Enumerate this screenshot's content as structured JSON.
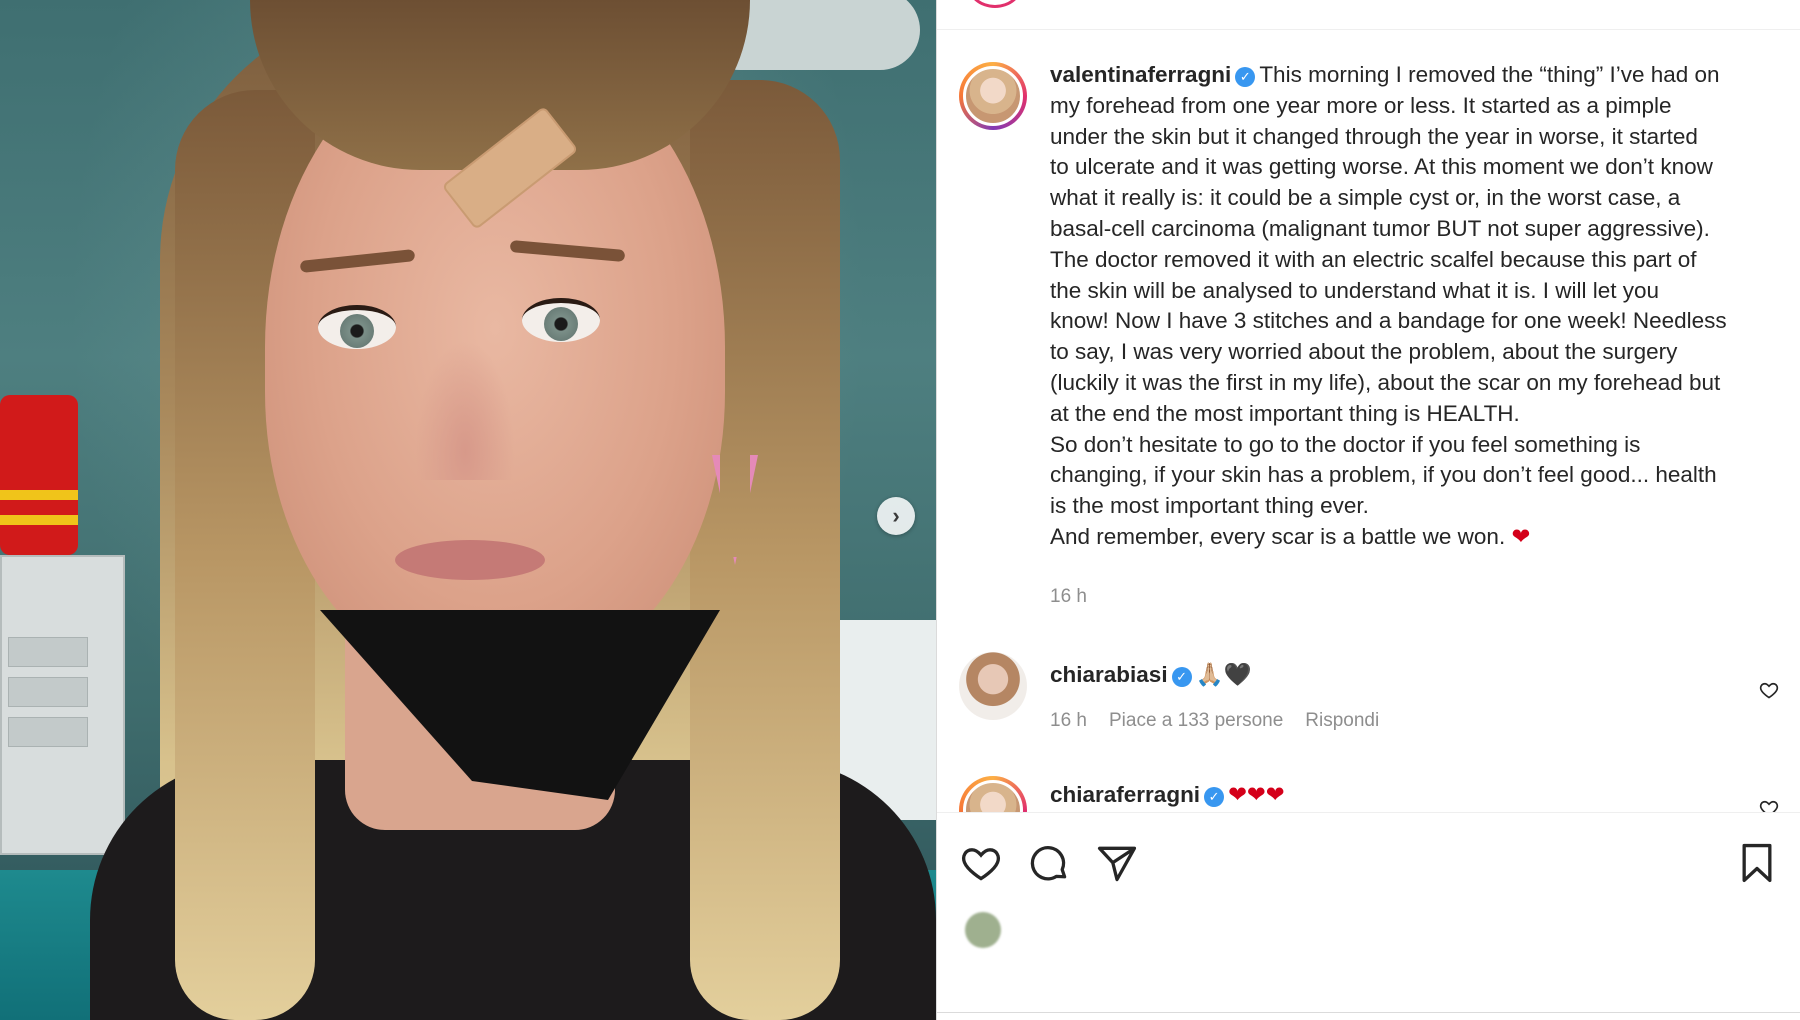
{
  "post": {
    "author": "valentinaferragni",
    "caption_lines": [
      "This morning I removed the “thing” I’ve had on",
      "my forehead from one year more or less. It started as a pimple",
      "under the skin but it changed through the year in worse, it started",
      "to ulcerate and it was getting worse. At this moment we don’t know",
      "what it really is: it could be a simple cyst or, in the worst case, a",
      "basal-cell carcinoma (malignant tumor BUT not super aggressive).",
      "The doctor removed it with an electric scalfel because this part of",
      "the skin will be analysed to understand what it is. I will let you",
      "know! Now I have 3 stitches and a bandage for one week! Needless",
      "to say, I was very worried about the problem, about the surgery",
      "(luckily it was the first in my life), about the scar on my forehead but",
      "at the end the most important thing is HEALTH.",
      "So don’t hesitate to go to the doctor if you feel something is",
      "changing, if your skin has a problem, if you don’t feel good... health",
      "is the most important thing ever.",
      "And remember, every scar is a battle we won."
    ],
    "caption_end_emoji": "❤",
    "time": "16 h"
  },
  "comments": [
    {
      "username": "chiarabiasi",
      "emoji": "🙏🏼🖤",
      "time": "16 h",
      "likes": "Piace a 133 persone",
      "reply": "Rispondi"
    },
    {
      "username": "chiaraferragni",
      "emoji": "❤❤❤"
    }
  ],
  "icons": {
    "verified": "verified-badge-icon",
    "like": "heart-icon",
    "comment": "comment-icon",
    "share": "share-icon",
    "save": "bookmark-icon",
    "next": "chevron-right-icon"
  },
  "colors": {
    "verified": "#3897f0",
    "heart_emoji": "#d4001a",
    "muted_text": "#8e8e8e"
  }
}
